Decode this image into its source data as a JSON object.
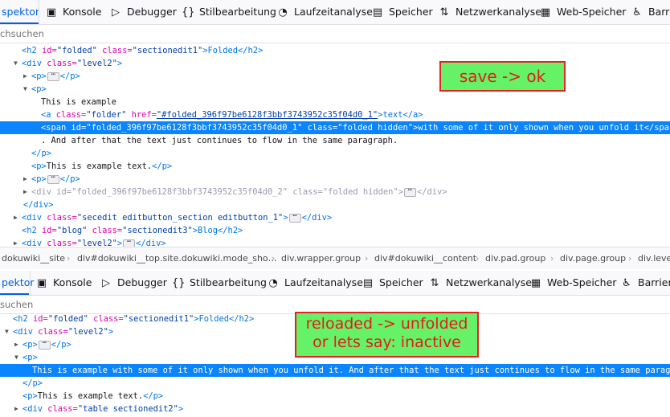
{
  "top_panel": {
    "tabs": [
      {
        "label": "spektor",
        "icon": "",
        "active": true
      },
      {
        "label": "Konsole",
        "icon": "console-icon"
      },
      {
        "label": "Debugger",
        "icon": "debugger-icon"
      },
      {
        "label": "Stilbearbeitung",
        "icon": "braces-icon"
      },
      {
        "label": "Laufzeitanalyse",
        "icon": "gauge-icon"
      },
      {
        "label": "Speicher",
        "icon": "chip-icon"
      },
      {
        "label": "Netzwerkanalyse",
        "icon": "arrows-updown-icon"
      },
      {
        "label": "Web-Speicher",
        "icon": "storage-icon"
      },
      {
        "label": "Barrie",
        "icon": "accessibility-icon"
      }
    ],
    "search_placeholder": "chsuchen",
    "lines": [
      {
        "a": "<h2 ",
        "b": "id=",
        "c": "\"folded\"",
        "d": " class=",
        "e": "\"sectionedit1\"",
        "f": ">Folded</h2>"
      },
      {
        "a": "<div ",
        "b": "class=",
        "c": "\"level2\"",
        "f": ">"
      },
      {
        "a": "<p>",
        "f": "</p>"
      },
      {
        "a": "<p>"
      },
      {
        "text": "This is example"
      },
      {
        "a": "<a ",
        "b": "class=",
        "c": "\"folder\"",
        "d": " href=",
        "link": "\"#folded_396f97be6128f3bbf3743952c35f04d0_1\"",
        "f": ">text</a>"
      },
      {
        "a": "<span ",
        "b": "id=",
        "c": "\"folded_396f97be6128f3bbf3743952c35f04d0_1\"",
        "d": " class=",
        "e": "\"folded hidden\"",
        "f": ">with some of it only shown when you unfold it</span>"
      },
      {
        "text": ". And after that the text just continues to flow in the same paragraph."
      },
      {
        "a": "</p>"
      },
      {
        "a": "<p>",
        "mid": "This is example text.",
        "f": "</p>"
      },
      {
        "a": "<p>",
        "f": "</p>"
      },
      {
        "a": "<div ",
        "b": "id=",
        "c": "\"folded_396f97be6128f3bbf3743952c35f04d0_2\"",
        "d": " class=",
        "e": "\"folded hidden\"",
        "f": ">",
        "g": "</div>"
      },
      {
        "a": "</div>"
      },
      {
        "a": "<div ",
        "b": "class=",
        "c": "\"secedit editbutton_section editbutton_1\"",
        "f": ">",
        "g": "</div>"
      },
      {
        "a": "<h2 ",
        "b": "id=",
        "c": "\"blog\"",
        "d": " class=",
        "e": "\"sectionedit3\"",
        "f": ">Blog</h2>"
      },
      {
        "a": "<div ",
        "b": "class=",
        "c": "\"level2\"",
        "f": ">",
        "g": "</div>"
      }
    ],
    "breadcrumbs": [
      "dokuwiki__site",
      "div#dokuwiki__top.site.dokuwiki.mode_sho…",
      "div.wrapper.group",
      "div#dokuwiki__content",
      "div.pad.group",
      "div.page.group",
      "div.level"
    ],
    "note": "save -> ok"
  },
  "bottom_panel": {
    "tabs": [
      {
        "label": "pektor",
        "active": true
      },
      {
        "label": "Konsole",
        "icon": "console-icon"
      },
      {
        "label": "Debugger",
        "icon": "debugger-icon"
      },
      {
        "label": "Stilbearbeitung",
        "icon": "braces-icon"
      },
      {
        "label": "Laufzeitanalyse",
        "icon": "gauge-icon"
      },
      {
        "label": "Speicher",
        "icon": "chip-icon"
      },
      {
        "label": "Netzwerkanalyse",
        "icon": "arrows-updown-icon"
      },
      {
        "label": "Web-Speicher",
        "icon": "storage-icon"
      },
      {
        "label": "Barriere",
        "icon": "accessibility-icon"
      }
    ],
    "search_placeholder": "suchen",
    "lines": [
      {
        "a": "<h2 ",
        "b": "id=",
        "c": "\"folded\"",
        "d": " class=",
        "e": "\"sectionedit1\"",
        "f": ">Folded</h2>"
      },
      {
        "a": "<div ",
        "b": "class=",
        "c": "\"level2\"",
        "f": ">"
      },
      {
        "a": "<p>",
        "f": "</p>"
      },
      {
        "a": "<p>"
      },
      {
        "text": "This is example with some of it only shown when you unfold it. And after that the text just continues to flow in the same paragraph."
      },
      {
        "a": "</p>"
      },
      {
        "a": "<p>",
        "mid": "This is example text.",
        "f": "</p>"
      },
      {
        "a": "<div ",
        "b": "class=",
        "c": "\"table sectionedit2\"",
        "f": ">"
      }
    ],
    "note_line1": "reloaded -> unfolded",
    "note_line2": "or lets say: inactive"
  },
  "colors": {
    "accent": "#0061e0",
    "selection": "#0a84ff",
    "tag": "#0074e8",
    "attr": "#dd00a9",
    "value": "#003eaa",
    "note_bg": "#66f266",
    "note_border": "#e42222"
  }
}
